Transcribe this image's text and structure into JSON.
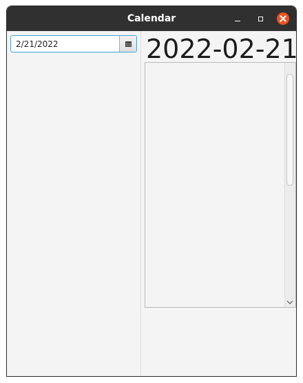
{
  "window": {
    "title": "Calendar"
  },
  "date_picker": {
    "value": "2/21/2022"
  },
  "selected_date_display": "2022-02-21"
}
